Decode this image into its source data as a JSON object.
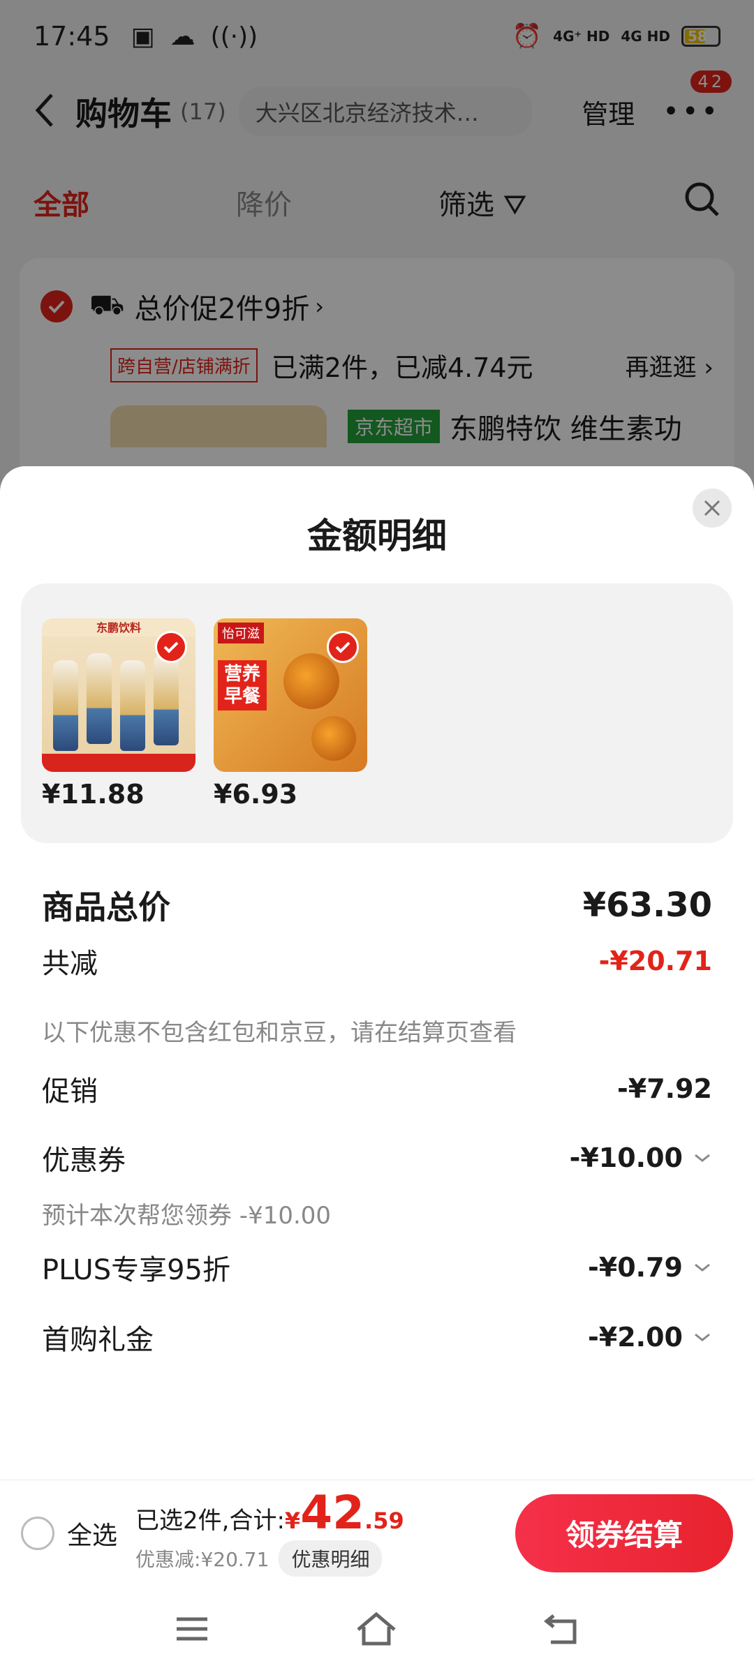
{
  "status_bar": {
    "time": "17:45",
    "network_1": "4G⁺ HD",
    "network_2": "4G HD",
    "battery": "58"
  },
  "nav": {
    "title": "购物车",
    "count": "(17)",
    "address": "大兴区北京经济技术…",
    "manage_label": "管理",
    "more_badge": "42"
  },
  "tabs": [
    {
      "label": "全部",
      "active": true
    },
    {
      "label": "降价",
      "active": false
    },
    {
      "label": "筛选",
      "active": false
    }
  ],
  "store_card": {
    "promo_title": "总价促2件9折",
    "promo_tag": "跨自营/店铺满折",
    "promo_status": "已满2件，已减4.74元",
    "promo_more": "再逛逛",
    "product_tag": "京东超市",
    "product_title": "东鹏特饮 维生素功"
  },
  "sheet": {
    "title": "金额明细",
    "products": [
      {
        "price": "¥11.88",
        "brand": "东鹏饮料",
        "image": "drink-bottles"
      },
      {
        "price": "¥6.93",
        "brand": "怡可滋",
        "badge": "营养早餐",
        "image": "egg-yolk-pastry"
      }
    ],
    "total_label": "商品总价",
    "total_value": "¥63.30",
    "discount_label": "共减",
    "discount_value": "-¥20.71",
    "discount_note": "以下优惠不包含红包和京豆，请在结算页查看",
    "items": [
      {
        "label": "促销",
        "value": "-¥7.92",
        "expandable": false
      },
      {
        "label": "优惠券",
        "value": "-¥10.00",
        "expandable": true,
        "note": "预计本次帮您领券 -¥10.00"
      },
      {
        "label": "PLUS专享95折",
        "value": "-¥0.79",
        "expandable": true
      },
      {
        "label": "首购礼金",
        "value": "-¥2.00",
        "expandable": true
      }
    ]
  },
  "checkout": {
    "select_all": "全选",
    "selected_text": "已选2件,合计:",
    "price_symbol": "¥",
    "price_int": "42",
    "price_dec": ".59",
    "discount_text": "优惠减:¥20.71",
    "detail_button": "优惠明细",
    "pay_button": "领券结算"
  },
  "colors": {
    "accent": "#e2231a",
    "sheet_bg": "#ffffff",
    "product_box_bg": "#f2f2f2"
  }
}
